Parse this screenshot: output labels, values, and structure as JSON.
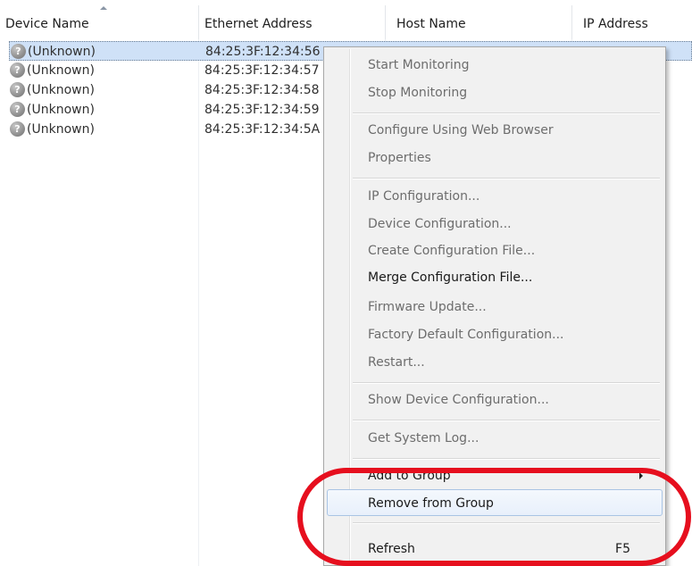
{
  "columns": {
    "device_name": "Device Name",
    "ethernet_address": "Ethernet Address",
    "host_name": "Host Name",
    "ip_address": "IP Address"
  },
  "devices": [
    {
      "name": "(Unknown)",
      "ethernet": "84:25:3F:12:34:56",
      "selected": true
    },
    {
      "name": "(Unknown)",
      "ethernet": "84:25:3F:12:34:57",
      "selected": false
    },
    {
      "name": "(Unknown)",
      "ethernet": "84:25:3F:12:34:58",
      "selected": false
    },
    {
      "name": "(Unknown)",
      "ethernet": "84:25:3F:12:34:59",
      "selected": false
    },
    {
      "name": "(Unknown)",
      "ethernet": "84:25:3F:12:34:5A",
      "selected": false
    }
  ],
  "device_icon": {
    "name": "unknown-device-icon",
    "glyph": "?"
  },
  "context_menu": {
    "start_monitoring": "Start Monitoring",
    "stop_monitoring": "Stop Monitoring",
    "configure_web": "Configure Using Web Browser",
    "properties": "Properties",
    "ip_configuration": "IP Configuration...",
    "device_configuration": "Device Configuration...",
    "create_config_file": "Create Configuration File...",
    "merge_config_file": "Merge Configuration File...",
    "firmware_update": "Firmware Update...",
    "factory_default": "Factory Default Configuration...",
    "restart": "Restart...",
    "show_device_config": "Show Device Configuration...",
    "get_system_log": "Get System Log...",
    "add_to_group": "Add to Group",
    "remove_from_group": "Remove from Group",
    "refresh": "Refresh",
    "refresh_shortcut": "F5"
  },
  "colors": {
    "annotation": "#e60f1e",
    "selection": "#cfe1f7",
    "menu_background": "#f1f1f1"
  }
}
